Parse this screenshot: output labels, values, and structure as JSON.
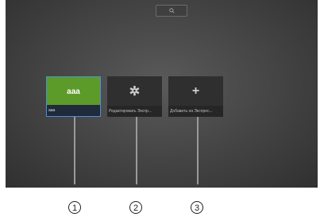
{
  "speed_dial": {
    "tiles": [
      {
        "thumb": "aaa",
        "caption": "aaa"
      },
      {
        "thumb_icon": "gear-icon",
        "caption": "Редактировать Экспр..."
      },
      {
        "thumb_icon": "plus-icon",
        "caption": "Добавить на Экспрес..."
      }
    ],
    "search_icon": "search-icon",
    "accent_color": "#5c9a2a",
    "selected_border_color": "#4a90d9"
  },
  "callouts": [
    "1",
    "2",
    "3"
  ]
}
